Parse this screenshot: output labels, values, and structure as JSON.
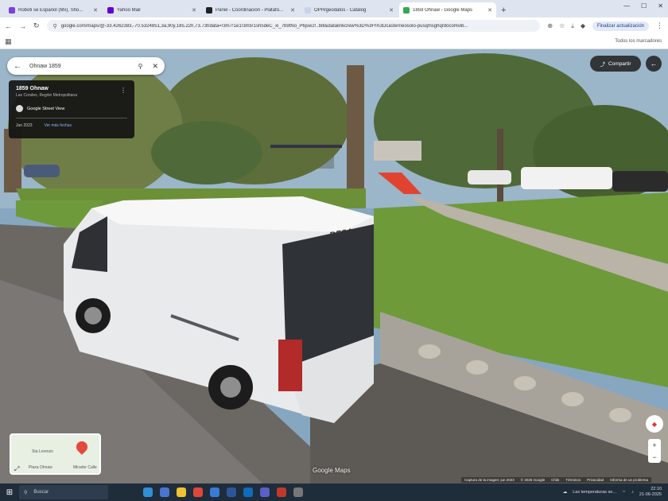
{
  "browser": {
    "tabs": [
      {
        "label": "Roboti se Español (Mx), Sho...",
        "color": "#7b3fe4"
      },
      {
        "label": "Yahoo Mail",
        "color": "#6001d2"
      },
      {
        "label": "Panel - Coordinación - Platafo...",
        "color": "#222222"
      },
      {
        "label": "OPH/geodatos - Catálog",
        "color": "#e8eef8"
      },
      {
        "label": "1859 Ohnaw - Google Maps",
        "color": "#34a853",
        "active": true
      }
    ],
    "new_tab": "+",
    "window_controls": [
      "—",
      "☐",
      "✕"
    ],
    "url": "google.com/maps/@-33.4262383,-70.5324851,3a,90y,185.22h,73.73t/data=!3m7!1e1!3m5!1sh5deC_xi_7b9tNo_P6jsw2!..bitl&datalinkcrew%3D%3Fl%3Dcasterneosolo-pusqmsghqrdocomvib...",
    "finish_button": "Finalizar actualización",
    "bookmarks_all": "Todos los marcadores"
  },
  "map": {
    "search_query": "Ohnaw 1859",
    "info": {
      "title": "1859 Ohnaw",
      "subtitle": "Las Condes, Región Metropolitana",
      "provider": "Google Street View",
      "date": "Jun 2023",
      "more_dates": "Ver más fechas"
    },
    "share_label": "Compartir",
    "minimap": {
      "label1": "Sta Lorenzo",
      "label2": "Plaza Ohnaw",
      "label3": "Mirador Calle"
    },
    "brand": "Google Maps",
    "attribution": [
      "Captura de la imagen: jun 2023",
      "© 2025 Google",
      "Chile",
      "Términos",
      "Privacidad",
      "Informa de un problema"
    ],
    "van_logo": "DFSA"
  },
  "taskbar": {
    "search_placeholder": "Buscar",
    "weather": "Las temperaturas se...",
    "time": "22:10",
    "date": "21-06-2025"
  }
}
